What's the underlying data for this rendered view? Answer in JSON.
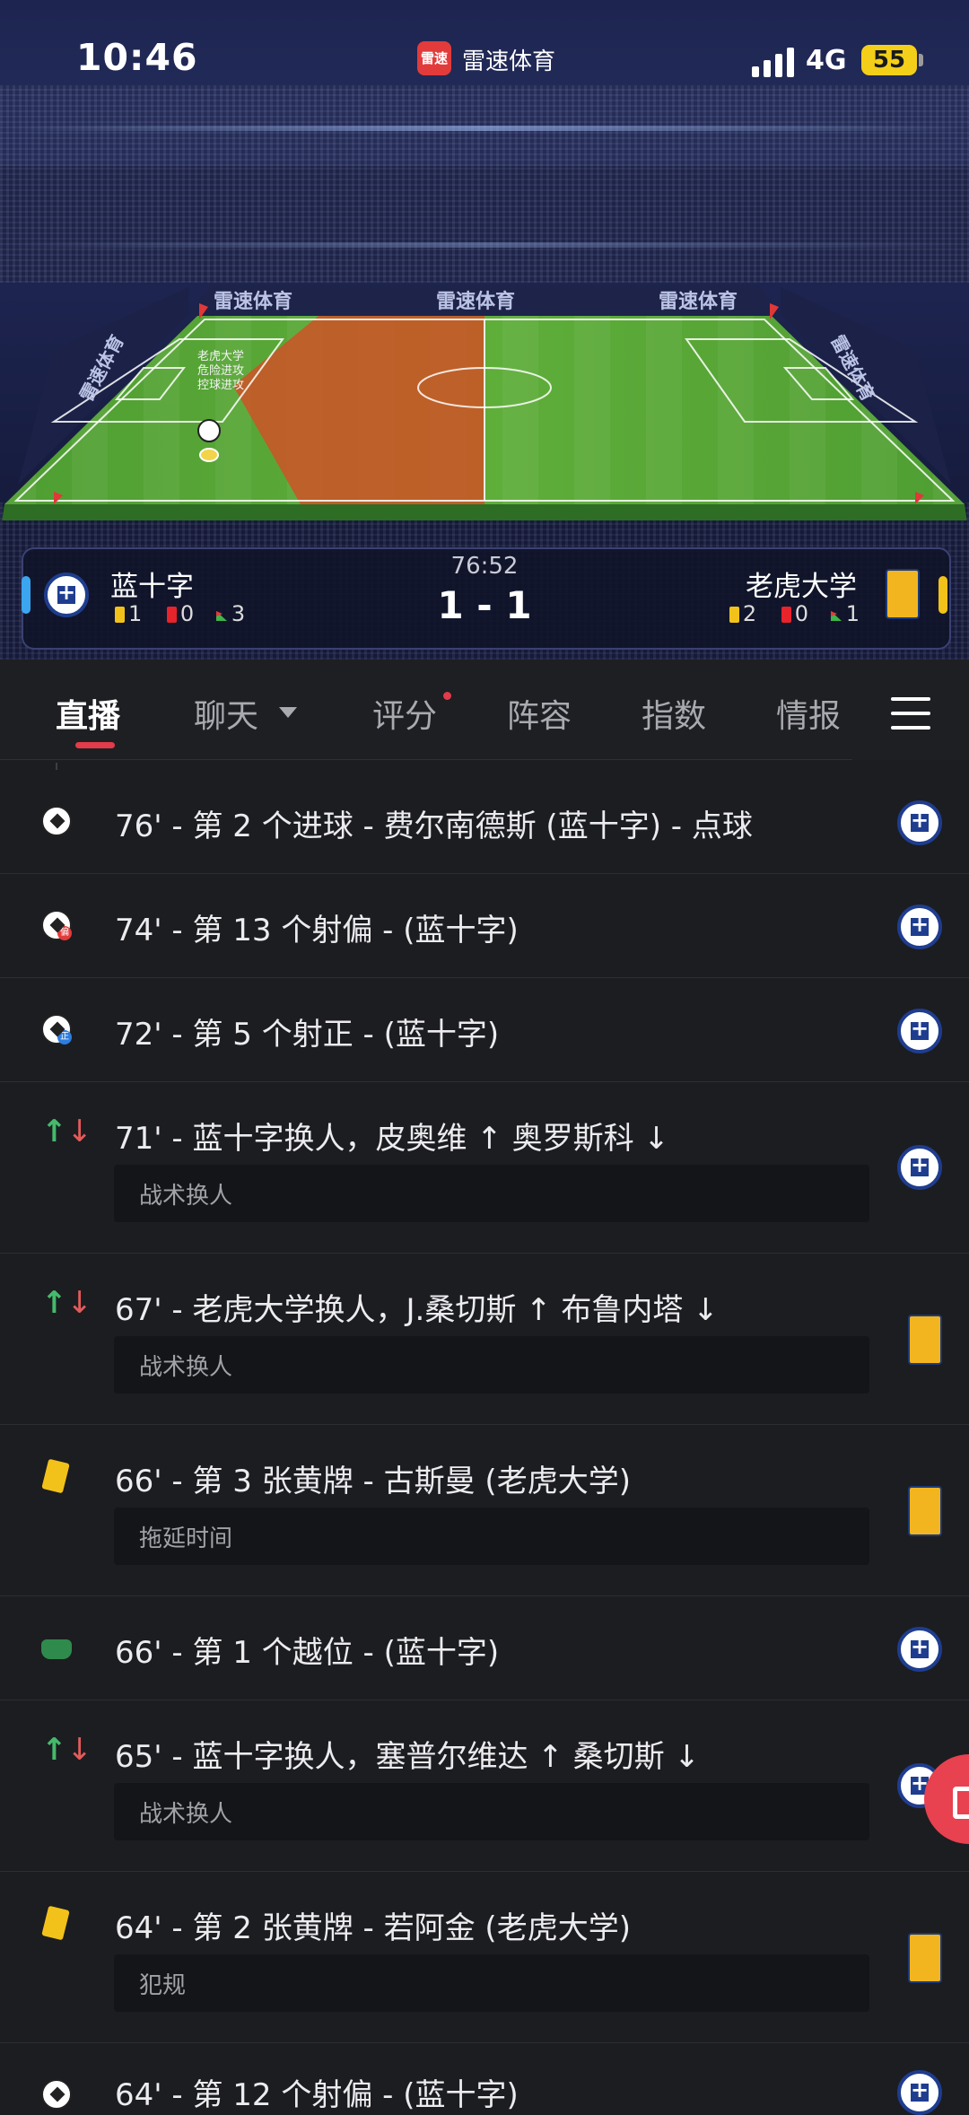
{
  "status_bar": {
    "time": "10:46",
    "app_logo_text": "雷速",
    "app_name": "雷速体育",
    "network": "4G",
    "battery": "55"
  },
  "pitch": {
    "ads": [
      "雷速体育",
      "雷速体育",
      "雷速体育",
      "雷速体育",
      "雷速体育"
    ],
    "possession_label_team": "老虎大学",
    "possession_label_action1": "危险进攻",
    "possession_label_action2": "控球进攻"
  },
  "match": {
    "time": "76:52",
    "score": "1 - 1",
    "home": {
      "name": "蓝十字",
      "yellow": "1",
      "red": "0",
      "corners": "3",
      "color": "#3ba6ef"
    },
    "away": {
      "name": "老虎大学",
      "yellow": "2",
      "red": "0",
      "corners": "1",
      "color": "#f3c21a"
    }
  },
  "tabs": [
    {
      "label": "直播",
      "active": true
    },
    {
      "label": "聊天"
    },
    {
      "label": "评分"
    },
    {
      "label": "阵容"
    },
    {
      "label": "指数"
    },
    {
      "label": "情报"
    }
  ],
  "events": [
    {
      "icon": "soccer-ball-icon",
      "text": "76' - 第 2 个进球 - 费尔南德斯 (蓝十字) - 点球",
      "note": "",
      "team": "home"
    },
    {
      "icon": "shot-off-target-icon",
      "text": "74' - 第 13 个射偏 - (蓝十字)",
      "note": "",
      "team": "home"
    },
    {
      "icon": "shot-on-target-icon",
      "text": "72' - 第 5 个射正 - (蓝十字)",
      "note": "",
      "team": "home"
    },
    {
      "icon": "substitution-icon",
      "text": "71' - 蓝十字换人，皮奥维 ↑ 奥罗斯科 ↓",
      "note": "战术换人",
      "team": "home"
    },
    {
      "icon": "substitution-icon",
      "text": "67' - 老虎大学换人，J.桑切斯 ↑ 布鲁内塔 ↓",
      "note": "战术换人",
      "team": "away"
    },
    {
      "icon": "yellow-card-icon",
      "text": "66' - 第 3 张黄牌 - 古斯曼 (老虎大学)",
      "note": "拖延时间",
      "team": "away"
    },
    {
      "icon": "offside-icon",
      "text": "66' - 第 1 个越位 - (蓝十字)",
      "note": "",
      "team": "home"
    },
    {
      "icon": "substitution-icon",
      "text": "65' - 蓝十字换人，塞普尔维达 ↑ 桑切斯 ↓",
      "note": "战术换人",
      "team": "home"
    },
    {
      "icon": "yellow-card-icon",
      "text": "64' - 第 2 张黄牌 - 若阿金 (老虎大学)",
      "note": "犯规",
      "team": "away"
    },
    {
      "icon": "shot-off-target-icon",
      "text": "64' - 第 12 个射偏 - (蓝十字)",
      "note": "",
      "team": "home"
    }
  ],
  "shot_tags": {
    "off": "偏",
    "on": "正"
  }
}
